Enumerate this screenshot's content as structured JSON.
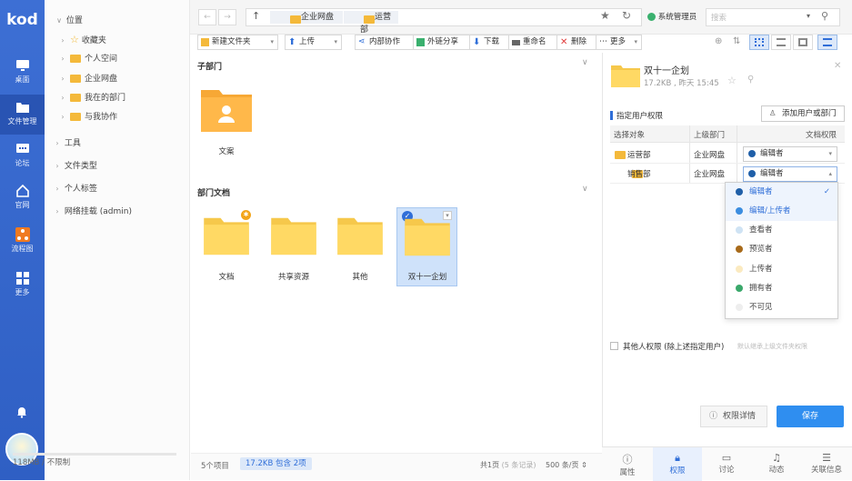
{
  "app": {
    "logo": "kod"
  },
  "nav": {
    "items": [
      {
        "label": "桌面",
        "icon": "desktop-icon"
      },
      {
        "label": "文件管理",
        "icon": "folder-icon"
      },
      {
        "label": "论坛",
        "icon": "forum-icon"
      },
      {
        "label": "官网",
        "icon": "home-icon"
      },
      {
        "label": "流程图",
        "icon": "flowchart-icon"
      },
      {
        "label": "更多",
        "icon": "grid-icon"
      }
    ]
  },
  "tree": {
    "root": "位置",
    "items": [
      "收藏夹",
      "个人空间",
      "企业网盘",
      "我在的部门",
      "与我协作"
    ],
    "groups": [
      "工具",
      "文件类型",
      "个人标签",
      "网络挂载 (admin)"
    ],
    "quota": "118MB / 不限制"
  },
  "breadcrumb": [
    "企业网盘",
    "运营部"
  ],
  "user": {
    "name": "系统管理员",
    "search_placeholder": "搜索"
  },
  "toolbar": {
    "new_folder": "新建文件夹",
    "upload": "上传",
    "internal_collab": "内部协作",
    "external_share": "外链分享",
    "download": "下载",
    "rename": "重命名",
    "delete": "删除",
    "more": "更多"
  },
  "main": {
    "section1": "子部门",
    "section1_items": [
      "文案"
    ],
    "section2": "部门文档",
    "section2_items": [
      "文档",
      "共享资源",
      "其他",
      "双十一企划"
    ]
  },
  "status": {
    "count": "5个项目",
    "selected": "17.2KB 包含 2项",
    "page": "共1页",
    "records": "(5 条记录)",
    "per_page": "500 条/页"
  },
  "panel": {
    "title": "双十一企划",
    "meta": "17.2KB , 昨天 15:45",
    "perm_title": "指定用户权限",
    "add_btn": "添加用户或部门",
    "headers": [
      "选择对象",
      "上级部门",
      "文档权限"
    ],
    "rows": [
      {
        "name": "运营部",
        "parent": "企业网盘",
        "perm": "编辑者"
      },
      {
        "name": "销售部",
        "parent": "企业网盘",
        "perm": "编辑者"
      }
    ],
    "options": [
      {
        "label": "编辑者",
        "color": "#1f5fa8"
      },
      {
        "label": "编辑/上传者",
        "color": "#3b8de0"
      },
      {
        "label": "查看者",
        "color": "#cfe3f4"
      },
      {
        "label": "预览者",
        "color": "#a86a1a"
      },
      {
        "label": "上传者",
        "color": "#fbeac0"
      },
      {
        "label": "拥有者",
        "color": "#3aa86b"
      },
      {
        "label": "不可见",
        "color": "#eeeeee"
      }
    ],
    "other_perm": "其他人权限 (除上述指定用户)",
    "other_hint": "默认继承上级文件夹权限",
    "detail_btn": "权限详情",
    "save_btn": "保存",
    "tabs": [
      "属性",
      "权限",
      "讨论",
      "动态",
      "关联信息"
    ]
  }
}
